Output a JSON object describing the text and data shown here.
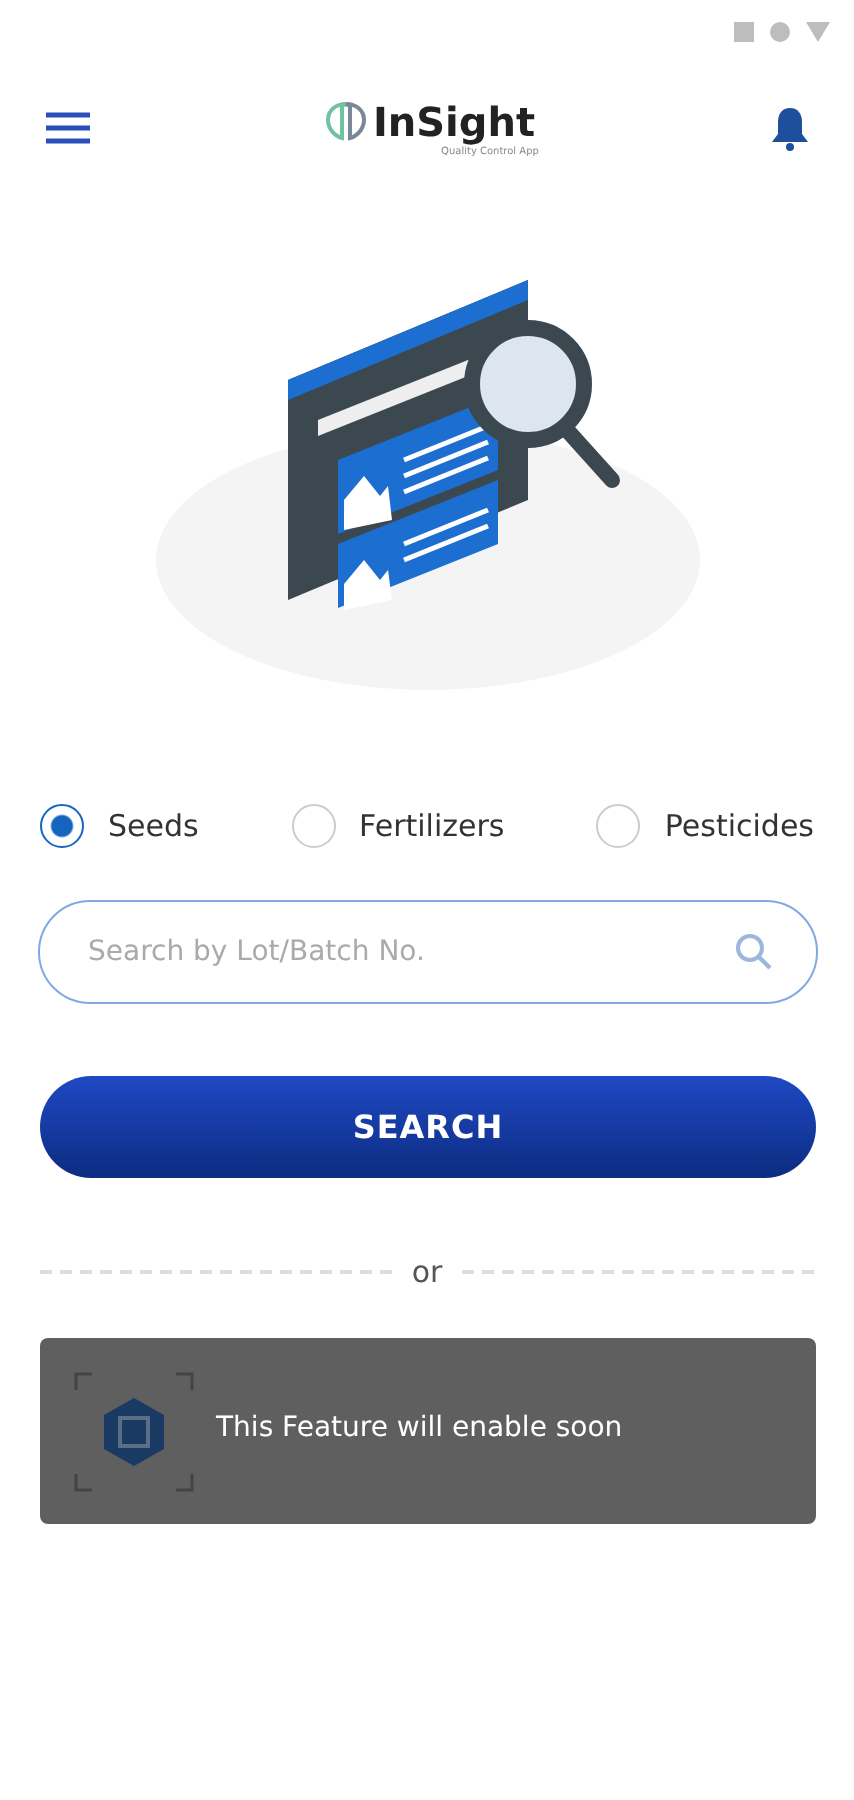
{
  "app_bar": {
    "title": "InSight",
    "subtitle": "Quality Control App"
  },
  "categories": [
    {
      "label": "Seeds",
      "selected": true
    },
    {
      "label": "Fertilizers",
      "selected": false
    },
    {
      "label": "Pesticides",
      "selected": false
    }
  ],
  "search": {
    "placeholder": "Search by Lot/Batch No."
  },
  "search_button": "SEARCH",
  "separator": "or",
  "qr_card": {
    "kind": "scan"
  },
  "toast": "This Feature will enable soon"
}
